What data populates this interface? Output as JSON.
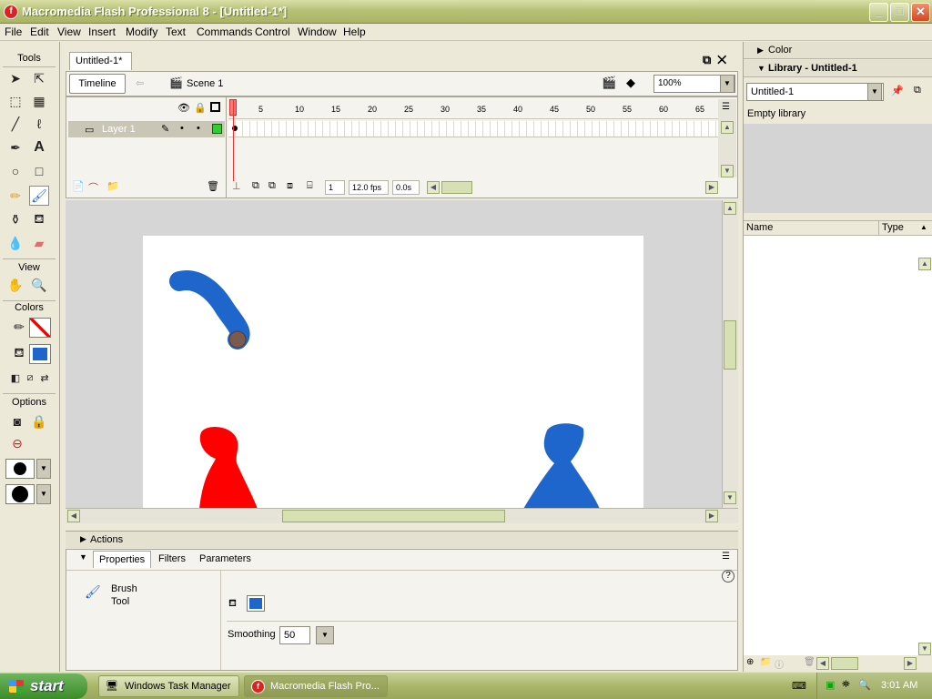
{
  "window": {
    "title": "Macromedia Flash Professional 8 - [Untitled-1*]",
    "app_icon_glyph": "f",
    "minimize_glyph": "_",
    "maximize_glyph": "□",
    "close_glyph": "✕"
  },
  "menu": [
    "File",
    "Edit",
    "View",
    "Insert",
    "Modify",
    "Text",
    "Commands",
    "Control",
    "Window",
    "Help"
  ],
  "tools_panel": {
    "title": "Tools",
    "view_label": "View",
    "colors_label": "Colors",
    "options_label": "Options",
    "active_tool": "brush-tool",
    "stroke_color": "#ff0000",
    "fill_color": "#1f66cc"
  },
  "document": {
    "tab_label": "Untitled-1*",
    "timeline_button": "Timeline",
    "scene_label": "Scene 1",
    "zoom": "100%"
  },
  "timeline": {
    "layer_name": "Layer 1",
    "frame_numbers": [
      "1",
      "5",
      "10",
      "15",
      "20",
      "25",
      "30",
      "35",
      "40",
      "45",
      "50",
      "55",
      "60",
      "65"
    ],
    "current_frame": "1",
    "frame_rate": "12.0 fps",
    "elapsed": "0.0s"
  },
  "stage": {
    "background": "#ffffff",
    "brush_stroke_color": "#1f66cc",
    "red_figure_color": "#ff0000",
    "blue_figure_color": "#1f66cc"
  },
  "panels": {
    "actions_label": "Actions",
    "tabs": [
      "Properties",
      "Filters",
      "Parameters"
    ],
    "tool_name_line1": "Brush",
    "tool_name_line2": "Tool",
    "smoothing_label": "Smoothing",
    "smoothing_value": "50"
  },
  "right_panel": {
    "color_label": "Color",
    "library_label": "Library - Untitled-1",
    "library_select": "Untitled-1",
    "empty_text": "Empty library",
    "col_name": "Name",
    "col_type": "Type"
  },
  "taskbar": {
    "start_label": "start",
    "tasks": [
      "Windows Task Manager",
      "Macromedia Flash Pro..."
    ],
    "clock": "3:01 AM"
  }
}
